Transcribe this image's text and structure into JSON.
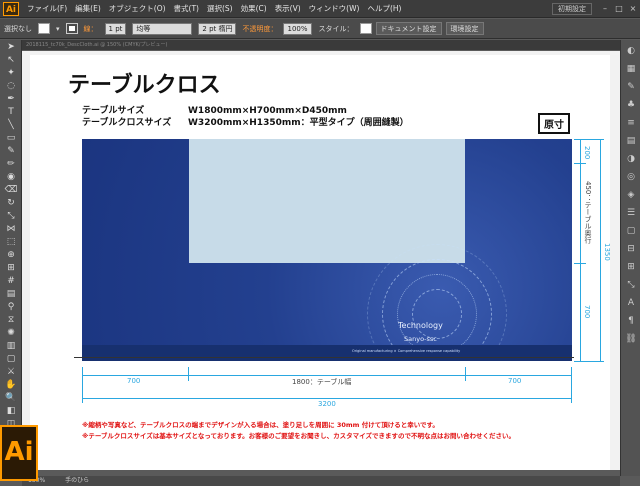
{
  "app": {
    "logo": "Ai",
    "big_logo": "Ai"
  },
  "menu": [
    "ファイル(F)",
    "編集(E)",
    "オブジェクト(O)",
    "書式(T)",
    "選択(S)",
    "効果(C)",
    "表示(V)",
    "ウィンドウ(W)",
    "ヘルプ(H)"
  ],
  "workspace": {
    "label": "初期設定",
    "minimize": "–",
    "maximize": "□",
    "close": "×"
  },
  "control": {
    "selection": "選択なし",
    "stroke_label": "線：",
    "stroke_weight": "1 pt",
    "profile": "均等",
    "brush": "2 pt 楕円",
    "opacity_label": "不透明度：",
    "opacity_value": "100%",
    "style_label": "スタイル：",
    "doc_setup": "ドキュメント設定",
    "prefs": "環境設定"
  },
  "tab": {
    "title": "2018115_tc70k_DescCloth.ai @ 150% (CMYK/プレビュー)"
  },
  "status": {
    "zoom": "150%",
    "tool": "手のひら"
  },
  "doc": {
    "title": "テーブルクロス",
    "spec1_key": "テーブルサイズ",
    "spec1_val": "W1800mm×H700mm×D450mm",
    "spec2_key": "テーブルクロスサイズ",
    "spec2_val": "W3200mm×H1350mm：平型タイプ（周囲縫製）",
    "badge": "原寸",
    "tech1": "Technology",
    "tech2": "Sanyo-ssc",
    "fineprint": "Original manufacturing  ×  Comprehensive response capability",
    "dim_left": "700",
    "dim_center": "1800：テーブル幅",
    "dim_right": "700",
    "dim_total": "3200",
    "dim_top": "200",
    "dim_depth": "450：テーブル奥行",
    "dim_drop": "700",
    "dim_height": "1350",
    "note1": "※縮柄や写真など、テーブルクロスの端までデザインが入る場合は、塗り足しを周囲に 30mm 付けて頂けると幸いです。",
    "note2": "※テーブルクロスサイズは基本サイズとなっております。お客様のご要望をお聞きし、カスタマイズできますので不明な点はお問い合わせください。"
  },
  "colors": {
    "cloth": "#1f3c8a",
    "table": "#c7dbe8",
    "dimension": "#2aa7e0",
    "note": "#e01010",
    "accent": "#ff9a00"
  }
}
